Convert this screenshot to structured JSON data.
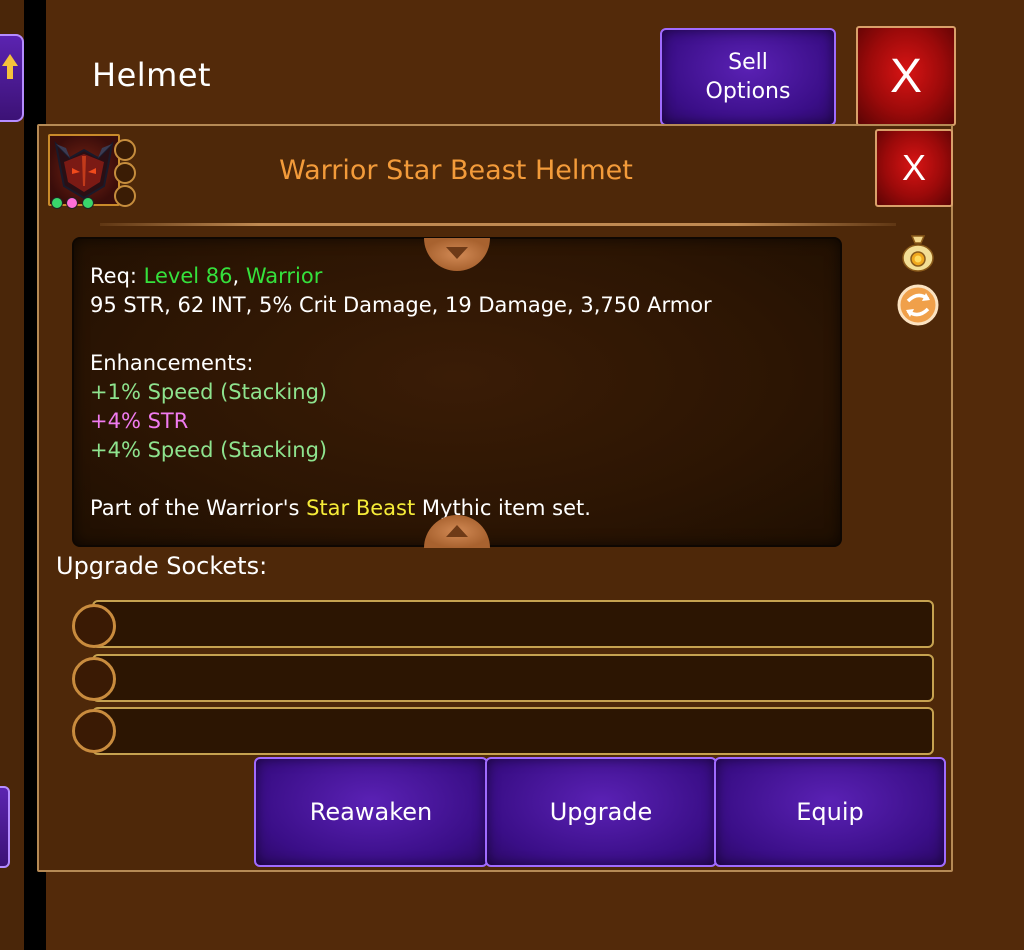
{
  "window": {
    "title": "Helmet",
    "sell_label_line1": "Sell",
    "sell_label_line2": "Options",
    "close_label": "X"
  },
  "item": {
    "name": "Warrior Star Beast Helmet",
    "close_label": "X",
    "gems": [
      "#39d66b",
      "#ff6fd8",
      "#39d66b"
    ],
    "requirements": {
      "prefix": "Req: ",
      "level": "Level 86",
      "separator": ", ",
      "class": "Warrior"
    },
    "stats": "95 STR, 62 INT, 5% Crit Damage, 19 Damage, 3,750 Armor",
    "enhancements_title": "Enhancements:",
    "enhancements": [
      {
        "text": "+1% Speed (Stacking)",
        "color": "#8ee38e"
      },
      {
        "text": "+4% STR",
        "color": "#f07bf0"
      },
      {
        "text": "+4% Speed (Stacking)",
        "color": "#8ee38e"
      }
    ],
    "set_text": {
      "before": "Part of the Warrior's ",
      "set_name": "Star Beast",
      "after": " Mythic item set."
    }
  },
  "side_icons": [
    "money-bag-icon",
    "swap-arrows-icon"
  ],
  "sockets": {
    "label": "Upgrade Sockets:",
    "count": 3
  },
  "actions": {
    "reawaken": "Reawaken",
    "upgrade": "Upgrade",
    "equip": "Equip"
  },
  "colors": {
    "background": "#532a0a",
    "panel": "#4e2809",
    "purple_button": "#3a0e87",
    "red_button": "#c00f0f",
    "item_name": "#f39b3a",
    "requirement_green": "#35e13c",
    "set_yellow": "#f6ec38"
  }
}
